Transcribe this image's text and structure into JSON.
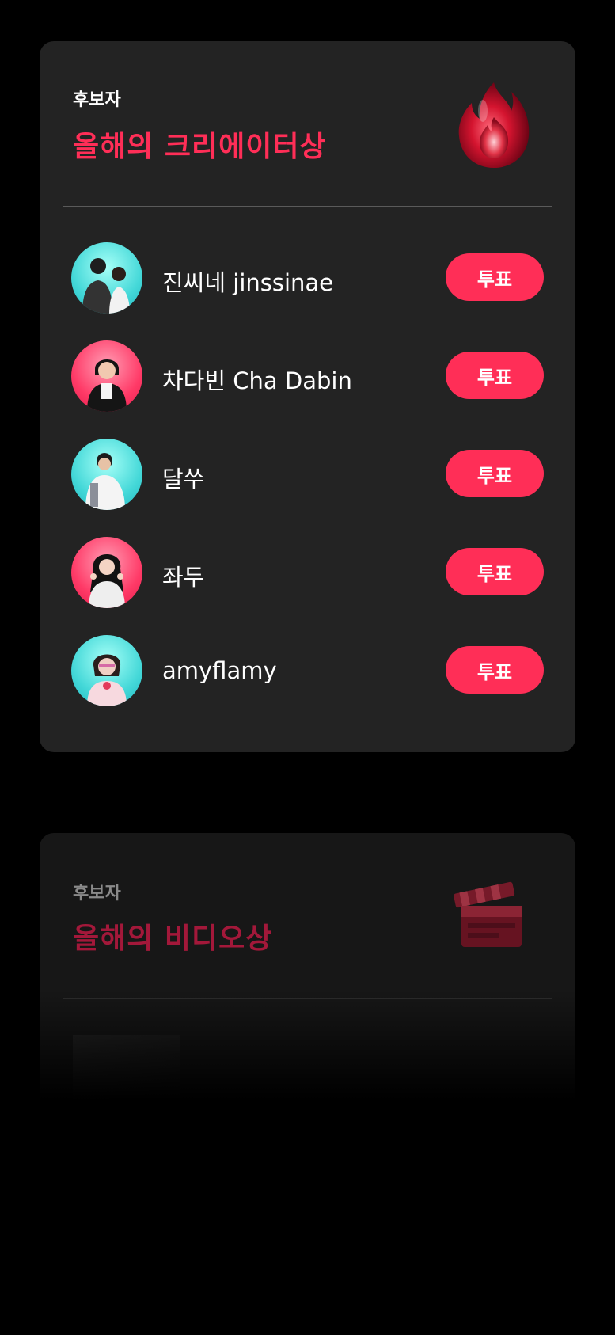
{
  "categories": [
    {
      "label": "후보자",
      "title": "올해의 크리에이터상",
      "icon": "fire-icon",
      "vote_label": "투표",
      "nominees": [
        {
          "name": "진씨네 jinssinae",
          "avatar_bg": "cyan"
        },
        {
          "name": "차다빈 Cha Dabin",
          "avatar_bg": "pink"
        },
        {
          "name": "달쑤",
          "avatar_bg": "cyan"
        },
        {
          "name": "좌두",
          "avatar_bg": "pink"
        },
        {
          "name": "amyflamy",
          "avatar_bg": "cyan"
        }
      ]
    },
    {
      "label": "후보자",
      "title": "올해의 비디오상",
      "icon": "clapperboard-icon"
    }
  ],
  "colors": {
    "accent": "#ff2e57",
    "card": "#232323",
    "background": "#000000"
  }
}
